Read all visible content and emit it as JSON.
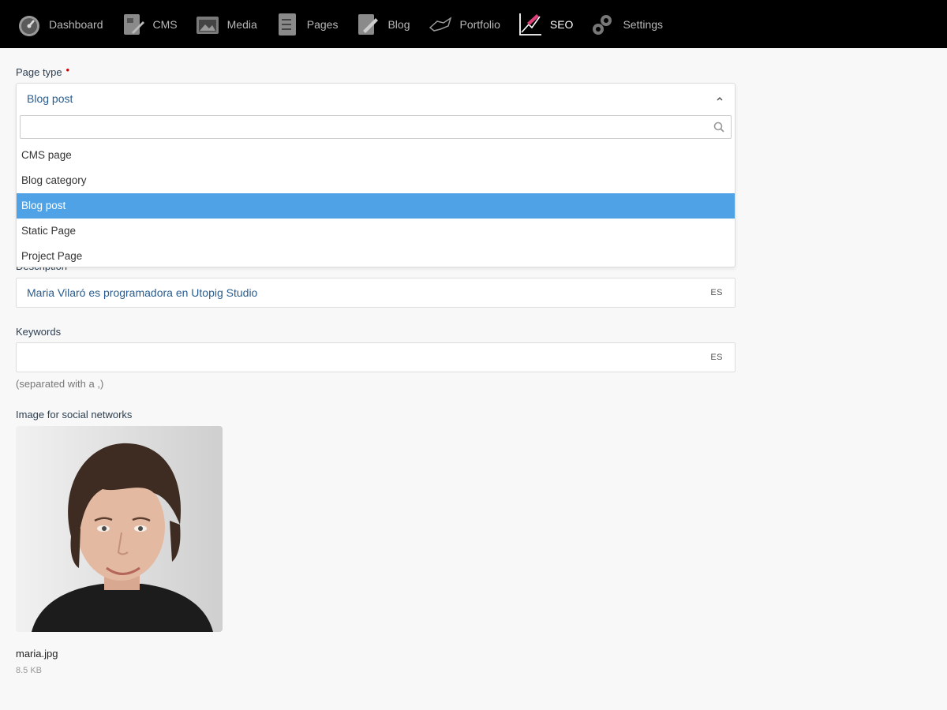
{
  "nav": {
    "items": [
      {
        "label": "Dashboard",
        "icon": "dashboard-icon"
      },
      {
        "label": "CMS",
        "icon": "cms-icon"
      },
      {
        "label": "Media",
        "icon": "media-icon"
      },
      {
        "label": "Pages",
        "icon": "pages-icon"
      },
      {
        "label": "Blog",
        "icon": "blog-icon"
      },
      {
        "label": "Portfolio",
        "icon": "portfolio-icon"
      },
      {
        "label": "SEO",
        "icon": "seo-icon",
        "active": true
      },
      {
        "label": "Settings",
        "icon": "gear-icon"
      }
    ]
  },
  "form": {
    "page_type": {
      "label": "Page type",
      "required_mark": "•",
      "selected": "Blog post",
      "search_placeholder": "",
      "options": [
        "CMS page",
        "Blog category",
        "Blog post",
        "Static Page",
        "Project Page"
      ],
      "selected_index": 2
    },
    "description": {
      "label": "Description",
      "value": "Maria Vilaró es programadora en Utopig Studio",
      "lang": "ES"
    },
    "keywords": {
      "label": "Keywords",
      "value": "",
      "lang": "ES",
      "hint": "(separated with a ,)"
    },
    "social_image": {
      "label": "Image for social networks",
      "filename": "maria.jpg",
      "filesize": "8.5 KB"
    }
  },
  "colors": {
    "nav_bg": "#000000",
    "highlight": "#50a2e6",
    "required": "#cc0000",
    "value_text": "#2a5d8f"
  }
}
